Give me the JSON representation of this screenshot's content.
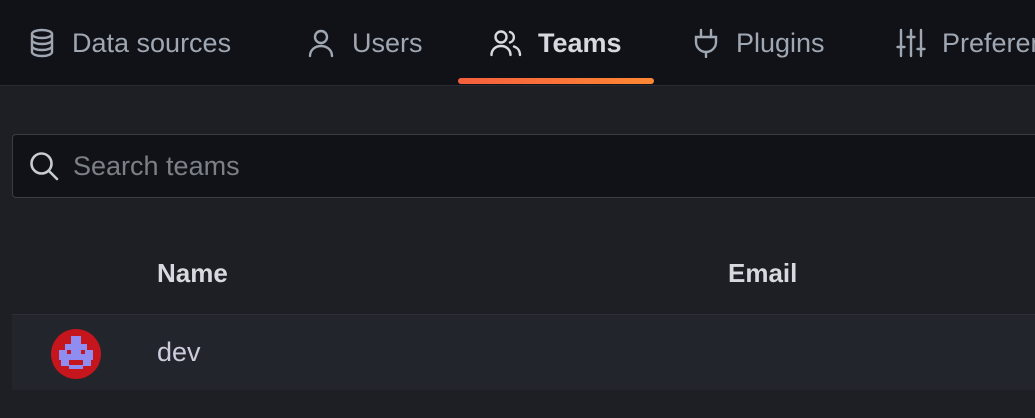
{
  "tabs": [
    {
      "label": "Data sources",
      "icon": "database-icon",
      "active": false
    },
    {
      "label": "Users",
      "icon": "user-icon",
      "active": false
    },
    {
      "label": "Teams",
      "icon": "users-icon",
      "active": true
    },
    {
      "label": "Plugins",
      "icon": "plug-icon",
      "active": false
    },
    {
      "label": "Preferences",
      "icon": "sliders-icon",
      "active": false
    }
  ],
  "search": {
    "placeholder": "Search teams",
    "value": ""
  },
  "table": {
    "columns": [
      "Name",
      "Email"
    ],
    "rows": [
      {
        "avatar": "team-avatar-icon",
        "name": "dev",
        "email": ""
      }
    ]
  },
  "colors": {
    "accent_gradient_start": "#f55f3e",
    "accent_gradient_end": "#ff8833",
    "avatar_bg": "#c4161c",
    "avatar_fg": "#8f8cf2"
  }
}
